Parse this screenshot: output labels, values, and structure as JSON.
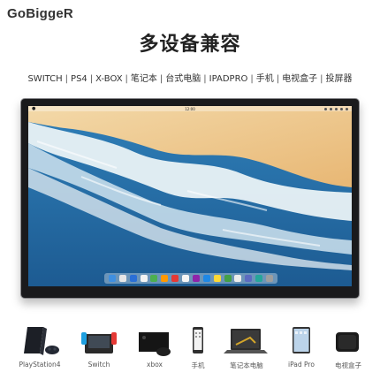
{
  "brand": {
    "logo_text": "GoBiggeR"
  },
  "headline": "多设备兼容",
  "compat_items": [
    "SWITCH",
    "PS4",
    "X-BOX",
    "笔记本",
    "台式电脑",
    "IPADPRO",
    "手机",
    "电视盒子",
    "投屏器"
  ],
  "screen": {
    "menubar_clock": "12:00"
  },
  "devices": [
    {
      "label": "PlayStation4",
      "icon": "ps4-console-icon"
    },
    {
      "label": "Switch",
      "icon": "switch-console-icon"
    },
    {
      "label": "xbox",
      "icon": "xbox-console-icon"
    },
    {
      "label": "手机",
      "icon": "phone-icon"
    },
    {
      "label": "笔记本电脑",
      "icon": "laptop-icon"
    },
    {
      "label": "iPad Pro",
      "icon": "tablet-icon"
    },
    {
      "label": "电视盒子",
      "icon": "tv-box-icon"
    }
  ]
}
